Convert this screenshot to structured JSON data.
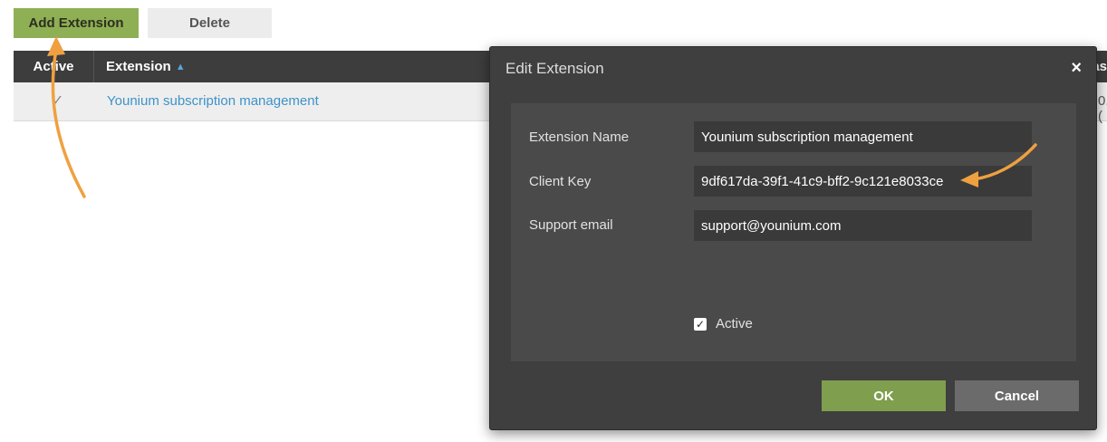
{
  "toolbar": {
    "add_label": "Add Extension",
    "delete_label": "Delete"
  },
  "table": {
    "columns": [
      "Active",
      "Extension",
      "as"
    ],
    "sort_indicator": "▲",
    "rows": [
      {
        "active": "✓",
        "extension": "Younium subscription management",
        "extra": "0.("
      }
    ]
  },
  "dialog": {
    "title": "Edit Extension",
    "close_icon": "×",
    "fields": {
      "name_label": "Extension Name",
      "name_value": "Younium subscription management",
      "client_key_label": "Client Key",
      "client_key_value": "9df617da-39f1-41c9-bff2-9c121e8033ce",
      "support_email_label": "Support email",
      "support_email_value": "support@younium.com"
    },
    "active_checkbox_label": "Active",
    "active_checked": true,
    "ok_label": "OK",
    "cancel_label": "Cancel"
  },
  "colors": {
    "accent_green": "#8faf55",
    "link_blue": "#3d93c9",
    "annotation_orange": "#f0a040"
  }
}
